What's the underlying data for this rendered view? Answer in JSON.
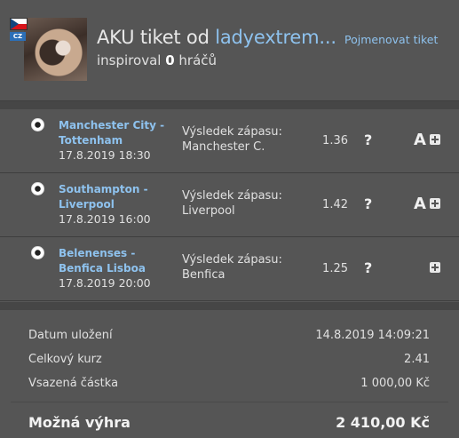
{
  "header": {
    "title_prefix": "AKU tiket od ",
    "username": "ladyextrem...",
    "inspired_prefix": "inspiroval ",
    "inspired_count": "0",
    "inspired_suffix": " hráčů",
    "rename_link": "Pojmenovat tiket",
    "country_code": "CZ"
  },
  "bets": [
    {
      "match": "Manchester City - Tottenham",
      "date": "17.8.2019 18:30",
      "result_label": "Výsledek zápasu:",
      "result_value": "Manchester C.",
      "odds": "1.36",
      "status": "?",
      "analysis": "A"
    },
    {
      "match": "Southampton - Liverpool",
      "date": "17.8.2019 16:00",
      "result_label": "Výsledek zápasu:",
      "result_value": "Liverpool",
      "odds": "1.42",
      "status": "?",
      "analysis": "A"
    },
    {
      "match": "Belenenses - Benfica Lisboa",
      "date": "17.8.2019 20:00",
      "result_label": "Výsledek zápasu:",
      "result_value": "Benfica",
      "odds": "1.25",
      "status": "?",
      "analysis": ""
    }
  ],
  "summary": {
    "saved_label": "Datum uložení",
    "saved_value": "14.8.2019 14:09:21",
    "odds_label": "Celkový kurz",
    "odds_value": "2.41",
    "stake_label": "Vsazená částka",
    "stake_value": "1 000,00 Kč",
    "win_label": "Možná výhra",
    "win_value": "2 410,00 Kč"
  },
  "colors": {
    "link": "#8ec2ee",
    "background": "#585858",
    "panel": "#555555"
  }
}
